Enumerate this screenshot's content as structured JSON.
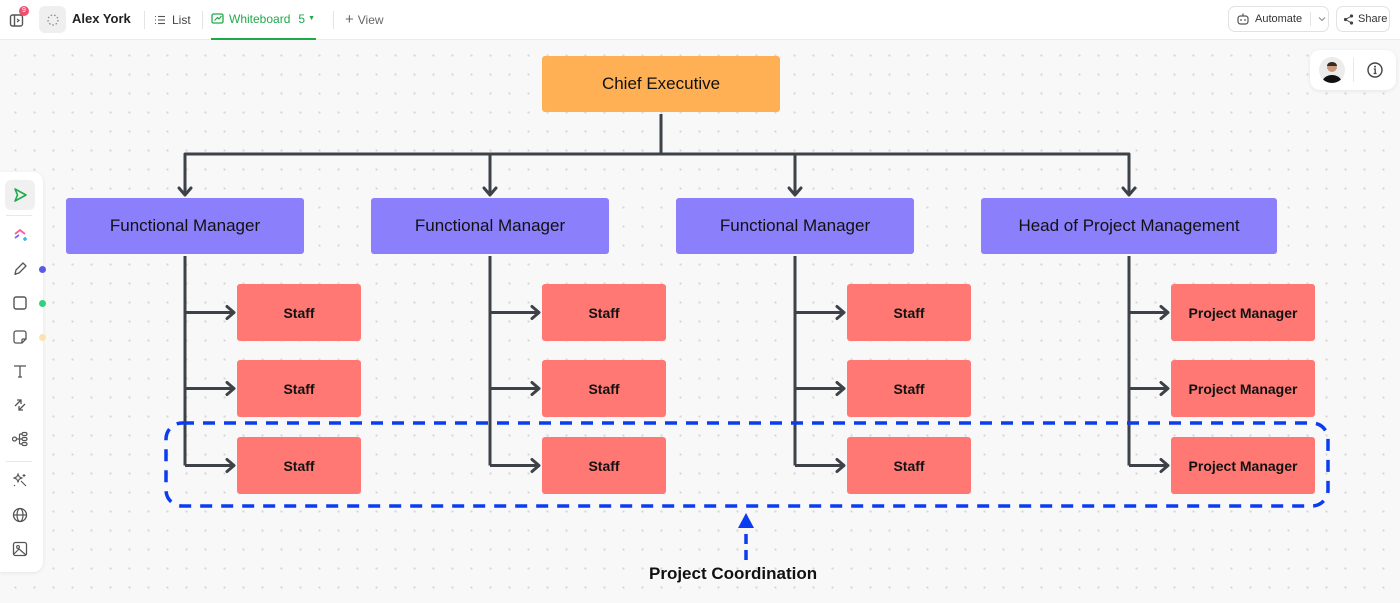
{
  "topbar": {
    "sidebar_badge_count": "9",
    "workspace_name": "Alex York",
    "tabs": [
      {
        "label": "List",
        "icon": "list-icon",
        "active": false
      },
      {
        "label": "Whiteboard",
        "icon": "whiteboard-icon",
        "active": true,
        "count": "5"
      }
    ],
    "add_view_label": "View",
    "automate_label": "Automate",
    "share_label": "Share",
    "accent_color": "#1eaa4a"
  },
  "toolbar": {
    "tools": [
      {
        "name": "select-tool",
        "icon": "cursor-arrow-icon",
        "active": true
      },
      {
        "name": "ai-shapes-tool",
        "icon": "clickup-ai-icon"
      },
      {
        "name": "pen-tool",
        "icon": "pen-icon",
        "color_dot": "#5b5be6"
      },
      {
        "name": "shape-tool",
        "icon": "square-icon",
        "color_dot": "#2bd47a"
      },
      {
        "name": "sticky-note-tool",
        "icon": "sticky-note-icon",
        "color_dot": "#fbe3b0"
      },
      {
        "name": "text-tool",
        "icon": "text-icon"
      },
      {
        "name": "connector-tool",
        "icon": "connector-arrows-icon"
      },
      {
        "name": "mind-map-tool",
        "icon": "mind-map-icon"
      },
      {
        "name": "magic-tool",
        "icon": "magic-wand-icon"
      },
      {
        "name": "embed-tool",
        "icon": "globe-icon"
      },
      {
        "name": "image-tool",
        "icon": "image-icon"
      }
    ]
  },
  "diagram": {
    "root": {
      "label": "Chief Executive",
      "color": "#ffb054"
    },
    "managers": [
      {
        "label": "Functional Manager",
        "reports": [
          "Staff",
          "Staff",
          "Staff"
        ]
      },
      {
        "label": "Functional Manager",
        "reports": [
          "Staff",
          "Staff",
          "Staff"
        ]
      },
      {
        "label": "Functional Manager",
        "reports": [
          "Staff",
          "Staff",
          "Staff"
        ]
      },
      {
        "label": "Head of Project Management",
        "reports": [
          "Project Manager",
          "Project Manager",
          "Project Manager"
        ]
      }
    ],
    "manager_color": "#8b7ffb",
    "report_color": "#ff7873",
    "connector_color": "#3c4248",
    "group": {
      "label": "Project Coordination",
      "color": "#0a3cf0"
    }
  }
}
